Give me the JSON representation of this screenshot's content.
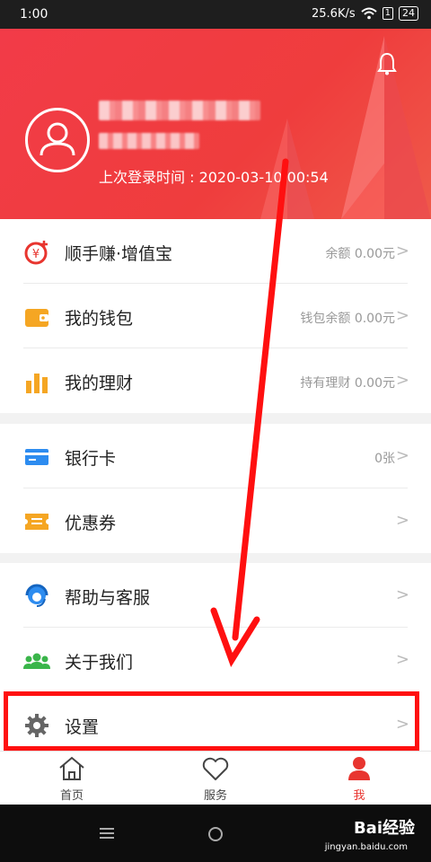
{
  "status_bar": {
    "time": "1:00",
    "speed": "25.6K/s",
    "sim": "1",
    "battery": "24"
  },
  "header": {
    "last_login": "上次登录时间 : 2020-03-10 00:54",
    "bell_icon": "bell-icon",
    "avatar_icon": "person-icon"
  },
  "menu_groups": [
    {
      "items": [
        {
          "label": "顺手赚·增值宝",
          "value": "余额 0.00元",
          "icon": "coin-plus-icon",
          "color": "#e8352f"
        },
        {
          "label": "我的钱包",
          "value": "钱包余额 0.00元",
          "icon": "wallet-icon",
          "color": "#f5a623"
        },
        {
          "label": "我的理财",
          "value": "持有理财 0.00元",
          "icon": "bar-chart-icon",
          "color": "#f5a623"
        }
      ]
    },
    {
      "items": [
        {
          "label": "银行卡",
          "value": "0张",
          "icon": "card-icon",
          "color": "#2d8cf0"
        },
        {
          "label": "优惠券",
          "value": "",
          "icon": "ticket-icon",
          "color": "#f5a623"
        }
      ]
    },
    {
      "items": [
        {
          "label": "帮助与客服",
          "value": "",
          "icon": "headset-icon",
          "color": "#2d8cf0"
        },
        {
          "label": "关于我们",
          "value": "",
          "icon": "people-icon",
          "color": "#3ab54a"
        },
        {
          "label": "设置",
          "value": "",
          "icon": "gear-icon",
          "color": "#666666"
        }
      ]
    }
  ],
  "chevron": ">",
  "tabs": [
    {
      "label": "首页",
      "icon": "home-icon",
      "active": false
    },
    {
      "label": "服务",
      "icon": "heart-icon",
      "active": false
    },
    {
      "label": "我",
      "icon": "user-icon",
      "active": true
    }
  ],
  "watermark": {
    "brand": "Bai经验",
    "url": "jingyan.baidu.com"
  },
  "colors": {
    "header_red": "#f23b48",
    "active_tab": "#e8352f",
    "highlight": "#ff1010"
  }
}
